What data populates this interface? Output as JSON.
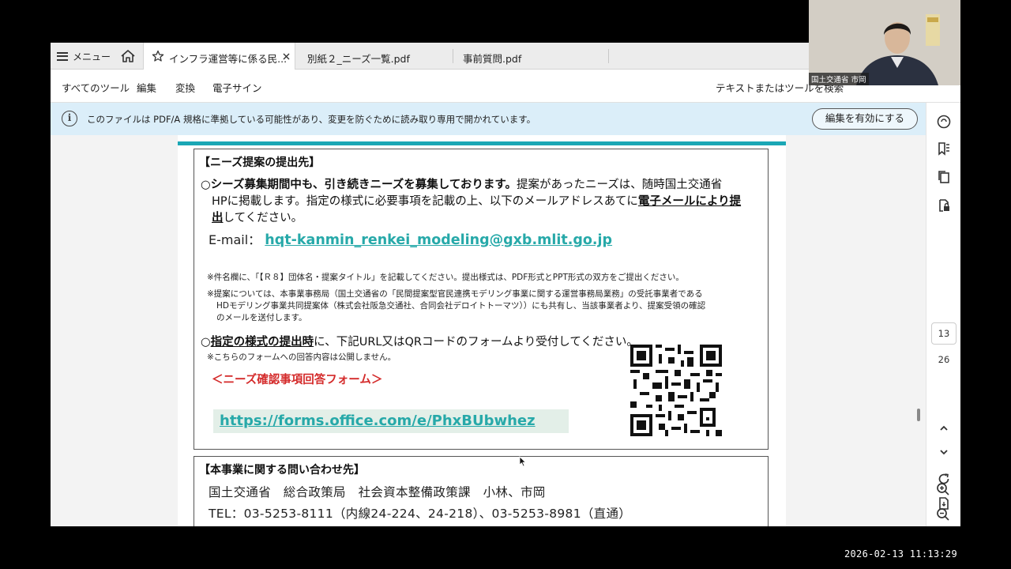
{
  "tabbar": {
    "menu_label": "メニュー",
    "tabs": [
      {
        "label": "インフラ運営等に係る民..."
      },
      {
        "label": "別紙２_ニーズ一覧.pdf"
      },
      {
        "label": "事前質問.pdf"
      }
    ]
  },
  "toolbar": {
    "items": [
      "すべてのツール",
      "編集",
      "変換",
      "電子サイン"
    ],
    "search_placeholder": "テキストまたはツールを検索"
  },
  "banner": {
    "message": "このファイルは PDF/A 規格に準拠している可能性があり、変更を防ぐために読み取り専用で開かれています。",
    "button_label": "編集を有効にする"
  },
  "doc": {
    "section1_heading": "【ニーズ提案の提出先】",
    "para1_bold": "○シーズ募集期間中も、引き続きニーズを募集しております。",
    "para1_rest": "提案があったニーズは、随時国土交通省",
    "para1_line2a": "HPに掲載します。指定の様式に必要事項を記載の上、以下のメールアドレスあてに",
    "para1_line2b": "電子メールにより提",
    "para1_line3a": "出",
    "para1_line3b": "してください。",
    "email_label": "E-mail：",
    "email": "hqt-kanmin_renkei_modeling@gxb.mlit.go.jp",
    "note1": "※件名欄に、「【Ｒ８】団体名・提案タイトル」を記載してください。提出様式は、PDF形式とPPT形式の双方をご提出ください。",
    "note2_l1": "※提案については、本事業事務局（国土交通省の「民間提案型官民連携モデリング事業に関する運営事務局業務」の受託事業者である",
    "note2_l2": "HDモデリング事業共同提案体（株式会社阪急交通社、合同会社デロイトトーマツ））にも共有し、当該事業者より、提案受領の確認",
    "note2_l3": "のメールを送付します。",
    "para2_a": "○",
    "para2_bold": "指定の様式の提出時",
    "para2_rest": "に、下記URL又はQRコードのフォームより受付してください。",
    "note3": "※こちらのフォームへの回答内容は公開しません。",
    "form_title": "＜ニーズ確認事項回答フォーム＞",
    "form_url": "https://forms.office.com/e/PhxBUbwhez",
    "section2_heading": "【本事業に関する問い合わせ先】",
    "contact_line1": "国土交通省　総合政策局　社会資本整備政策課　小林、市岡",
    "contact_line2": "TEL：03-5253-8111（内線24-224、24-218）、03-5253-8981（直通）"
  },
  "nav": {
    "current_page": "13",
    "total_pages": "26"
  },
  "webcam": {
    "name_label": "国土交通省 市岡"
  },
  "timestamp": "2026-02-13  11:13:29"
}
